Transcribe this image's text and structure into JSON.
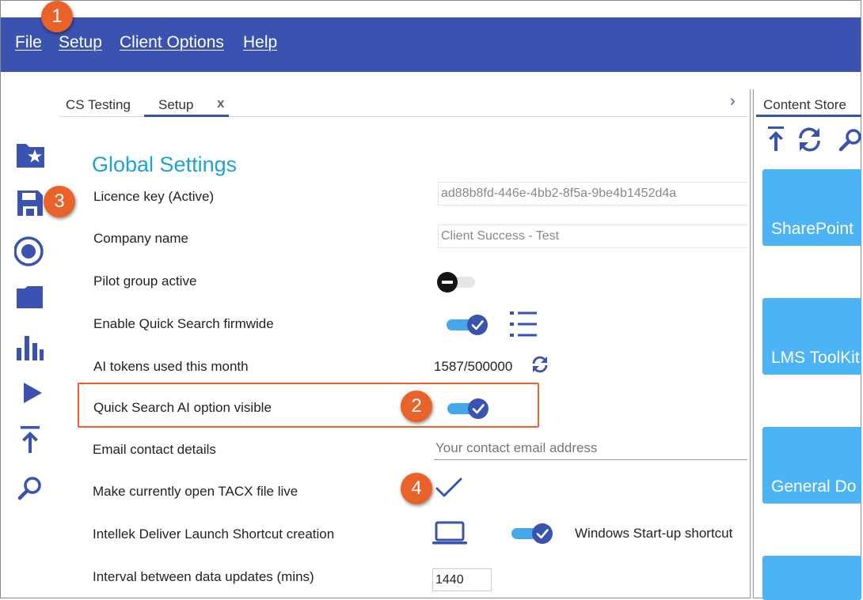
{
  "menu": {
    "file": "File",
    "setup": "Setup",
    "client_options": "Client Options",
    "help": "Help"
  },
  "callouts": {
    "one": "1",
    "two": "2",
    "three": "3",
    "four": "4"
  },
  "tabs": {
    "cs_testing": "CS Testing",
    "setup": "Setup",
    "close": "x",
    "chevron": "›"
  },
  "settings": {
    "heading": "Global Settings",
    "licence_key_label": "Licence key (Active)",
    "licence_key_value": "ad88b8fd-446e-4bb2-8f5a-9be4b1452d4a",
    "company_name_label": "Company name",
    "company_name_value": "Client Success - Test",
    "pilot_group_label": "Pilot group active",
    "pilot_group_on": false,
    "quick_search_label": "Enable Quick Search firmwide",
    "quick_search_on": true,
    "ai_tokens_label": "AI tokens used this month",
    "ai_tokens_value": "1587/500000",
    "quick_search_ai_label": "Quick Search AI option visible",
    "quick_search_ai_on": true,
    "email_label": "Email contact details",
    "email_placeholder": "Your contact email address",
    "tacx_label": "Make currently open TACX file live",
    "shortcut_label": "Intellek Deliver Launch Shortcut creation",
    "shortcut_toggle_on": true,
    "startup_shortcut_label": "Windows Start-up shortcut",
    "interval_label": "Interval between data updates (mins)",
    "interval_value": "1440"
  },
  "content_store": {
    "title": "Content Store",
    "tiles": [
      "SharePoint",
      "LMS ToolKit",
      "General Do",
      ""
    ]
  },
  "colors": {
    "menubar": "#3a52b0",
    "accent": "#3a52b0",
    "toggle_track": "#45a7ea",
    "heading": "#1ba3d6",
    "callout": "#e8622a",
    "tile": "#4cb3f4"
  },
  "icons": {
    "sidebar": [
      "folder-star-icon",
      "save-icon",
      "radio-target-icon",
      "folder-icon",
      "bar-chart-icon",
      "play-icon",
      "upload-icon",
      "search-icon"
    ],
    "content_store": [
      "upload-icon",
      "refresh-icon",
      "search-icon"
    ],
    "quick_search_list": "list-icon",
    "ai_tokens_refresh": "refresh-icon",
    "tacx_live": "checkmark-icon",
    "shortcut": "laptop-icon"
  }
}
